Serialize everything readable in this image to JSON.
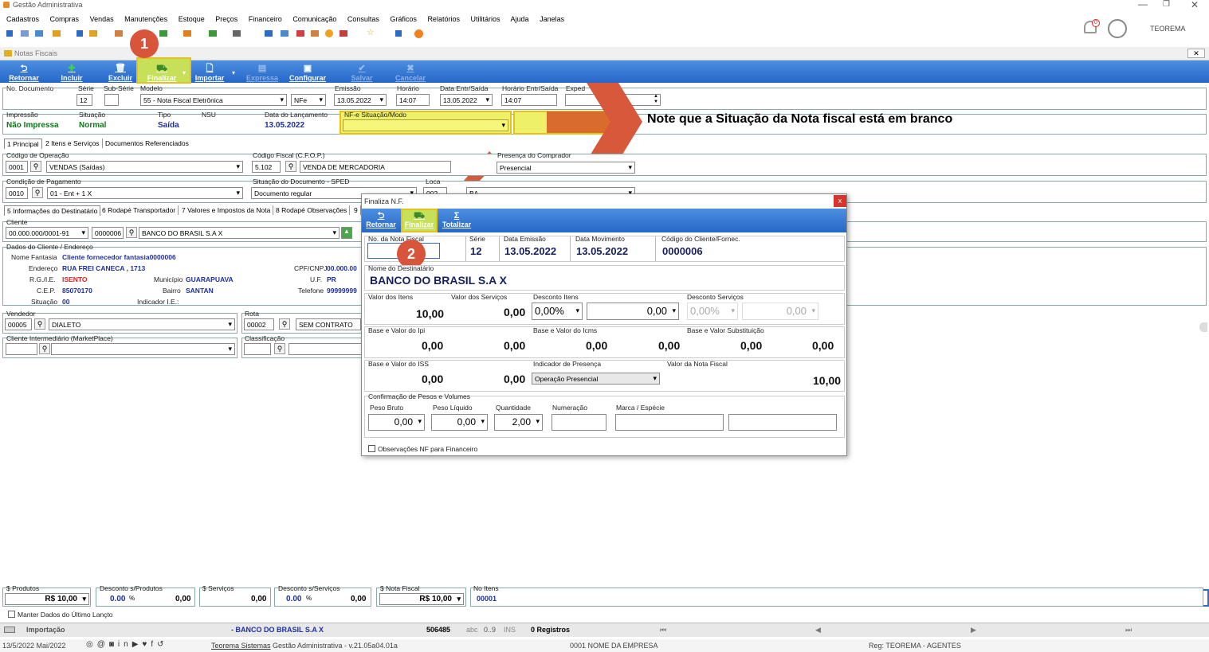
{
  "window": {
    "title": "Gestão Administrativa",
    "user": "TEOREMA",
    "notifications": "0"
  },
  "menu": [
    "Cadastros",
    "Compras",
    "Vendas",
    "Manutenções",
    "Estoque",
    "Preços",
    "Financeiro",
    "Comunicação",
    "Consultas",
    "Gráficos",
    "Relatórios",
    "Utilitários",
    "Ajuda",
    "Janelas"
  ],
  "subwindow": {
    "title": "Notas Fiscais"
  },
  "toolbar": {
    "retornar": "Retornar",
    "incluir": "Incluir",
    "excluir": "Excluir",
    "finalizar": "Finalizar",
    "importar": "Importar",
    "expressa": "Expressa",
    "configurar": "Configurar",
    "salvar": "Salvar",
    "cancelar": "Cancelar"
  },
  "annotations": {
    "step1": "1",
    "step2": "2",
    "note": "Note que a Situação da Nota fiscal está em branco"
  },
  "header": {
    "no_documento_label": "No. Documento",
    "serie_label": "Série",
    "serie": "12",
    "sub_serie_label": "Sub-Série",
    "modelo_label": "Modelo",
    "modelo": "55 - Nota Fiscal Eletrônica",
    "modelo_tipo": "NFe",
    "emissao_label": "Emissão",
    "emissao": "13.05.2022",
    "horario_label": "Horário",
    "horario": "14:07",
    "data_entr_label": "Data Entr/Saída",
    "data_entr": "13.05.2022",
    "horario_entr_label": "Horário Entr/Saída",
    "horario_entr": "14:07",
    "expedicao_label": "Exped",
    "impressao_label": "Impressão",
    "impressao": "Não Impressa",
    "situacao_label": "Situação",
    "situacao": "Normal",
    "tipo_label": "Tipo",
    "tipo": "Saída",
    "nsu_label": "NSU",
    "data_lanc_label": "Data do Lançamento",
    "data_lanc": "13.05.2022",
    "nfe_situacao_label": "NF-e Situação/Modo"
  },
  "tabs": [
    "1 Principal",
    "2 Itens e Serviços",
    "Documentos Referenciados"
  ],
  "principal": {
    "cod_operacao_label": "Código de Operação",
    "cod_operacao": "0001",
    "operacao": "VENDAS (Saídas)",
    "cfop_label": "Código Fiscal (C.F.O.P.)",
    "cfop": "5.102",
    "cfop_desc": "VENDA DE MERCADORIA",
    "presenca_label": "Presença do Comprador",
    "presenca": "Presencial",
    "cond_pag_label": "Condição de Pagamento",
    "cond_pag": "0010",
    "cond_pag_desc": "01 - Ent + 1 X",
    "sit_doc_label": "Situação do Documento - SPED",
    "sit_doc": "Documento regular",
    "local_label": "Loca",
    "local_code": "002",
    "local_desc": "BA"
  },
  "subtabs": [
    "5 Informações do Destinatário",
    "6 Rodapé Transportador",
    "7 Valores e Impostos da Nota",
    "8 Rodapé Observações",
    "9"
  ],
  "cliente": {
    "label": "Cliente",
    "cnpj": "00.000.000/0001-91",
    "codigo": "0000006",
    "nome": "BANCO DO BRASIL S.A X",
    "dados_label": "Dados do Cliente / Endereço",
    "fantasia_label": "Nome Fantasia",
    "fantasia": "Cliente fornecedor fantasia0000006",
    "endereco_label": "Endereço",
    "endereco": "RUA FREI CANECA , 1713",
    "cpf_label": "CPF/CNPJ",
    "cpf": "00.000.00",
    "rg_label": "R.G./I.E.",
    "rg": "ISENTO",
    "municipio_label": "Município",
    "municipio": "GUARAPUAVA",
    "uf_label": "U.F.",
    "uf": "PR",
    "cep_label": "C.E.P.",
    "cep": "85070170",
    "bairro_label": "Bairro",
    "bairro": "SANTAN",
    "telefone_label": "Telefone",
    "telefone": "99999999",
    "situacao_label": "Situação",
    "situacao": "00",
    "indicador_label": "Indicador I.E.:"
  },
  "vendedor": {
    "label": "Vendedor",
    "codigo": "00005",
    "nome": "DIALETO",
    "rota_label": "Rota",
    "rota_codigo": "00002",
    "rota": "SEM CONTRATO"
  },
  "intermediario": {
    "label": "Cliente Intermediário (MarketPlace)",
    "classificacao_label": "Classificação"
  },
  "dialog": {
    "title": "Finaliza N.F.",
    "close": "x",
    "retornar": "Retornar",
    "finalizar": "Finalizar",
    "totalizar": "Totalizar",
    "no_nota_label": "No. da Nota Fiscal",
    "serie_label": "Série",
    "serie": "12",
    "emissao_label": "Data Emissão",
    "emissao": "13.05.2022",
    "movimento_label": "Data Movimento",
    "movimento": "13.05.2022",
    "cod_cliente_label": "Código do Cliente/Fornec.",
    "cod_cliente": "0000006",
    "destinatario_label": "Nome do Destinatário",
    "destinatario": "BANCO DO BRASIL S.A X",
    "valor_itens_label": "Valor dos Itens",
    "valor_itens": "10,00",
    "valor_servicos_label": "Valor dos Serviços",
    "valor_servicos": "0,00",
    "desc_itens_label": "Desconto Itens",
    "desc_itens_pct": "0,00%",
    "desc_itens_val": "0,00",
    "desc_serv_label": "Desconto Serviços",
    "desc_serv_pct": "0,00%",
    "desc_serv_val": "0,00",
    "ipi_label": "Base e Valor do Ipi",
    "ipi_base": "0,00",
    "ipi_val": "0,00",
    "icms_label": "Base e Valor do Icms",
    "icms_base": "0,00",
    "icms_val": "0,00",
    "subst_label": "Base e Valor Substituição",
    "subst_base": "0,00",
    "subst_val": "0,00",
    "iss_label": "Base e Valor do ISS",
    "iss_base": "0,00",
    "iss_val": "0,00",
    "presenca_label": "Indicador de Presença",
    "presenca": "Operação Presencial",
    "valor_nota_label": "Valor da Nota Fiscal",
    "valor_nota": "10,00",
    "pesos_label": "Confirmação de Pesos e Volumes",
    "peso_bruto_label": "Peso Bruto",
    "peso_bruto": "0,00",
    "peso_liq_label": "Peso Líquido",
    "peso_liq": "0,00",
    "quantidade_label": "Quantidade",
    "quantidade": "2,00",
    "numeracao_label": "Numeração",
    "marca_label": "Marca / Espécie",
    "obs_label": "Observações NF para Financeiro"
  },
  "totals": {
    "produtos_label": "$ Produtos",
    "produtos": "R$ 10,00",
    "desc_prod_label": "Desconto s/Produtos",
    "desc_prod_pct": "0.00",
    "desc_prod_val": "0,00",
    "servicos_label": "$ Serviços",
    "servicos": "0,00",
    "desc_serv_label": "Desconto s/Serviços",
    "desc_serv_pct": "0.00",
    "desc_serv_val": "0,00",
    "nota_label": "$ Nota Fiscal",
    "nota": "R$ 10,00",
    "no_itens_label": "No Itens",
    "no_itens": "00001",
    "manter_label": "Manter Dados do Último Lançto"
  },
  "statusbar": {
    "importacao": "Importação",
    "cliente": "- BANCO DO BRASIL S.A X",
    "numero": "506485",
    "abc": "abc",
    "range": "0..9",
    "ins": "INS",
    "registros": "0 Registros"
  },
  "footer": {
    "data": "13/5/2022 Mai/2022",
    "empresa_link": "Teorema Sistemas",
    "versao": "Gestão Administrativa - v.21.05a04.01a",
    "empresa": "0001 NOME DA EMPRESA",
    "reg": "Reg: TEOREMA - AGENTES"
  }
}
